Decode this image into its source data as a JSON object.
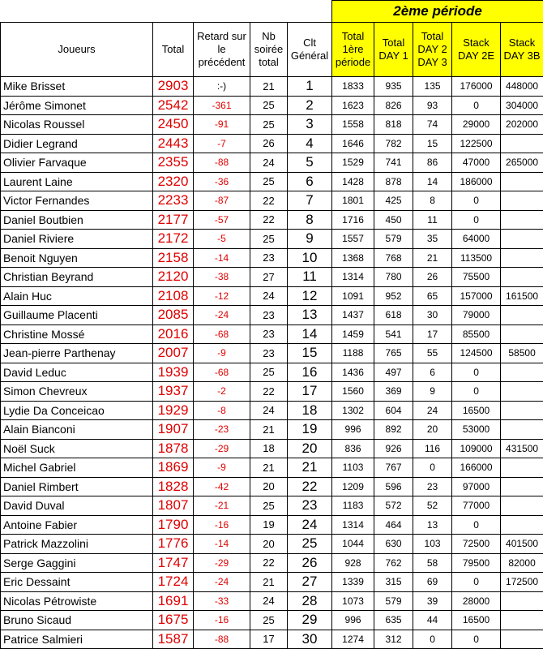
{
  "period_label": "2ème période",
  "headers": {
    "joueurs": "Joueurs",
    "total": "Total",
    "retard": "Retard sur le précédent",
    "nb": "Nb soirée total",
    "clt": "Clt Général",
    "total1": "Total 1ère période",
    "day1": "Total DAY 1",
    "day23": "Total DAY 2 DAY 3",
    "stack2e": "Stack DAY 2E",
    "stack3b": "Stack DAY 3B"
  },
  "rows": [
    {
      "name": "Mike Brisset",
      "total": "2903",
      "retard": ":-)",
      "nb": "21",
      "rank": "1",
      "t1": "1833",
      "d1": "935",
      "d23": "135",
      "s2e": "176000",
      "s3b": "448000"
    },
    {
      "name": "Jérôme Simonet",
      "total": "2542",
      "retard": "-361",
      "nb": "25",
      "rank": "2",
      "t1": "1623",
      "d1": "826",
      "d23": "93",
      "s2e": "0",
      "s3b": "304000"
    },
    {
      "name": "Nicolas Roussel",
      "total": "2450",
      "retard": "-91",
      "nb": "25",
      "rank": "3",
      "t1": "1558",
      "d1": "818",
      "d23": "74",
      "s2e": "29000",
      "s3b": "202000"
    },
    {
      "name": "Didier Legrand",
      "total": "2443",
      "retard": "-7",
      "nb": "26",
      "rank": "4",
      "t1": "1646",
      "d1": "782",
      "d23": "15",
      "s2e": "122500",
      "s3b": ""
    },
    {
      "name": "Olivier Farvaque",
      "total": "2355",
      "retard": "-88",
      "nb": "24",
      "rank": "5",
      "t1": "1529",
      "d1": "741",
      "d23": "86",
      "s2e": "47000",
      "s3b": "265000"
    },
    {
      "name": "Laurent Laine",
      "total": "2320",
      "retard": "-36",
      "nb": "25",
      "rank": "6",
      "t1": "1428",
      "d1": "878",
      "d23": "14",
      "s2e": "186000",
      "s3b": ""
    },
    {
      "name": "Victor Fernandes",
      "total": "2233",
      "retard": "-87",
      "nb": "22",
      "rank": "7",
      "t1": "1801",
      "d1": "425",
      "d23": "8",
      "s2e": "0",
      "s3b": ""
    },
    {
      "name": "Daniel Boutbien",
      "total": "2177",
      "retard": "-57",
      "nb": "22",
      "rank": "8",
      "t1": "1716",
      "d1": "450",
      "d23": "11",
      "s2e": "0",
      "s3b": ""
    },
    {
      "name": "Daniel Riviere",
      "total": "2172",
      "retard": "-5",
      "nb": "25",
      "rank": "9",
      "t1": "1557",
      "d1": "579",
      "d23": "35",
      "s2e": "64000",
      "s3b": ""
    },
    {
      "name": "Benoit Nguyen",
      "total": "2158",
      "retard": "-14",
      "nb": "23",
      "rank": "10",
      "t1": "1368",
      "d1": "768",
      "d23": "21",
      "s2e": "113500",
      "s3b": ""
    },
    {
      "name": "Christian Beyrand",
      "total": "2120",
      "retard": "-38",
      "nb": "27",
      "rank": "11",
      "t1": "1314",
      "d1": "780",
      "d23": "26",
      "s2e": "75500",
      "s3b": ""
    },
    {
      "name": "Alain Huc",
      "total": "2108",
      "retard": "-12",
      "nb": "24",
      "rank": "12",
      "t1": "1091",
      "d1": "952",
      "d23": "65",
      "s2e": "157000",
      "s3b": "161500"
    },
    {
      "name": "Guillaume Placenti",
      "total": "2085",
      "retard": "-24",
      "nb": "23",
      "rank": "13",
      "t1": "1437",
      "d1": "618",
      "d23": "30",
      "s2e": "79000",
      "s3b": ""
    },
    {
      "name": "Christine Mossé",
      "total": "2016",
      "retard": "-68",
      "nb": "23",
      "rank": "14",
      "t1": "1459",
      "d1": "541",
      "d23": "17",
      "s2e": "85500",
      "s3b": ""
    },
    {
      "name": "Jean-pierre Parthenay",
      "total": "2007",
      "retard": "-9",
      "nb": "23",
      "rank": "15",
      "t1": "1188",
      "d1": "765",
      "d23": "55",
      "s2e": "124500",
      "s3b": "58500"
    },
    {
      "name": "David Leduc",
      "total": "1939",
      "retard": "-68",
      "nb": "25",
      "rank": "16",
      "t1": "1436",
      "d1": "497",
      "d23": "6",
      "s2e": "0",
      "s3b": ""
    },
    {
      "name": "Simon Chevreux",
      "total": "1937",
      "retard": "-2",
      "nb": "22",
      "rank": "17",
      "t1": "1560",
      "d1": "369",
      "d23": "9",
      "s2e": "0",
      "s3b": ""
    },
    {
      "name": "Lydie Da Conceicao",
      "total": "1929",
      "retard": "-8",
      "nb": "24",
      "rank": "18",
      "t1": "1302",
      "d1": "604",
      "d23": "24",
      "s2e": "16500",
      "s3b": ""
    },
    {
      "name": "Alain Bianconi",
      "total": "1907",
      "retard": "-23",
      "nb": "21",
      "rank": "19",
      "t1": "996",
      "d1": "892",
      "d23": "20",
      "s2e": "53000",
      "s3b": ""
    },
    {
      "name": "Noël Suck",
      "total": "1878",
      "retard": "-29",
      "nb": "18",
      "rank": "20",
      "t1": "836",
      "d1": "926",
      "d23": "116",
      "s2e": "109000",
      "s3b": "431500"
    },
    {
      "name": "Michel Gabriel",
      "total": "1869",
      "retard": "-9",
      "nb": "21",
      "rank": "21",
      "t1": "1103",
      "d1": "767",
      "d23": "0",
      "s2e": "166000",
      "s3b": ""
    },
    {
      "name": "Daniel Rimbert",
      "total": "1828",
      "retard": "-42",
      "nb": "20",
      "rank": "22",
      "t1": "1209",
      "d1": "596",
      "d23": "23",
      "s2e": "97000",
      "s3b": ""
    },
    {
      "name": "David Duval",
      "total": "1807",
      "retard": "-21",
      "nb": "25",
      "rank": "23",
      "t1": "1183",
      "d1": "572",
      "d23": "52",
      "s2e": "77000",
      "s3b": ""
    },
    {
      "name": "Antoine Fabier",
      "total": "1790",
      "retard": "-16",
      "nb": "19",
      "rank": "24",
      "t1": "1314",
      "d1": "464",
      "d23": "13",
      "s2e": "0",
      "s3b": ""
    },
    {
      "name": "Patrick Mazzolini",
      "total": "1776",
      "retard": "-14",
      "nb": "20",
      "rank": "25",
      "t1": "1044",
      "d1": "630",
      "d23": "103",
      "s2e": "72500",
      "s3b": "401500"
    },
    {
      "name": "Serge Gaggini",
      "total": "1747",
      "retard": "-29",
      "nb": "22",
      "rank": "26",
      "t1": "928",
      "d1": "762",
      "d23": "58",
      "s2e": "79500",
      "s3b": "82000"
    },
    {
      "name": "Eric Dessaint",
      "total": "1724",
      "retard": "-24",
      "nb": "21",
      "rank": "27",
      "t1": "1339",
      "d1": "315",
      "d23": "69",
      "s2e": "0",
      "s3b": "172500"
    },
    {
      "name": "Nicolas Pétrowiste",
      "total": "1691",
      "retard": "-33",
      "nb": "24",
      "rank": "28",
      "t1": "1073",
      "d1": "579",
      "d23": "39",
      "s2e": "28000",
      "s3b": ""
    },
    {
      "name": "Bruno Sicaud",
      "total": "1675",
      "retard": "-16",
      "nb": "25",
      "rank": "29",
      "t1": "996",
      "d1": "635",
      "d23": "44",
      "s2e": "16500",
      "s3b": ""
    },
    {
      "name": "Patrice Salmieri",
      "total": "1587",
      "retard": "-88",
      "nb": "17",
      "rank": "30",
      "t1": "1274",
      "d1": "312",
      "d23": "0",
      "s2e": "0",
      "s3b": ""
    }
  ]
}
